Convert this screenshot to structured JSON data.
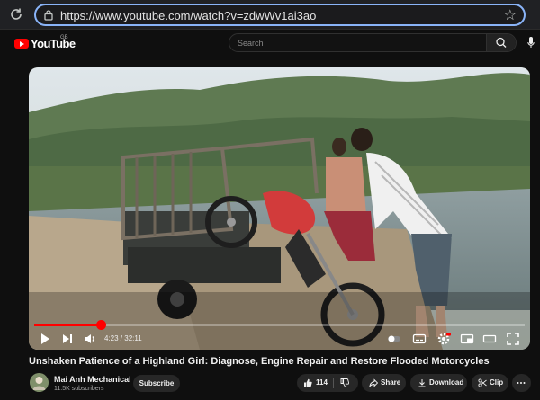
{
  "browser": {
    "url": "https://www.youtube.com/watch?v=zdwWv1ai3ao"
  },
  "header": {
    "logo_text": "YouTube",
    "country_code": "GB",
    "search_placeholder": "Search"
  },
  "player": {
    "current_time": "4:23",
    "duration": "32:11",
    "time_display": "4:23 / 32:11",
    "progress_fraction": 0.136
  },
  "video": {
    "title": "Unshaken Patience of a Highland Girl: Diagnose, Engine Repair and Restore Flooded Motorcycles"
  },
  "channel": {
    "name": "Mai Anh Mechanical",
    "subscribers": "11.5K subscribers",
    "subscribe_label": "Subscribe"
  },
  "actions": {
    "like_count": "114",
    "share_label": "Share",
    "download_label": "Download",
    "clip_label": "Clip"
  },
  "colors": {
    "brand_red": "#ff0000",
    "focus_ring": "#8ab4f8",
    "background": "#0f0f0f",
    "pill": "#272727"
  }
}
